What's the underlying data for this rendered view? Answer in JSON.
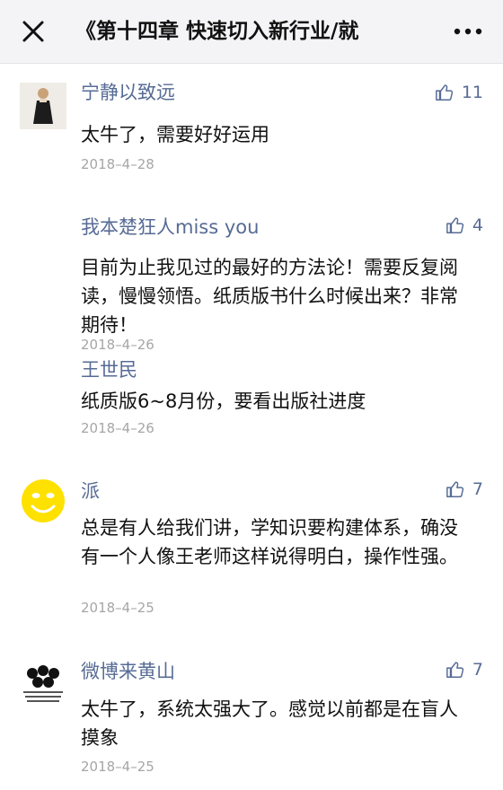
{
  "header": {
    "title": "《第十四章 快速切入新行业/就",
    "close_icon": "close-icon",
    "more_icon": "more-dots-icon"
  },
  "colors": {
    "nickname": "#576b95",
    "date": "#a6a6a6",
    "topbar_bg": "#f4f4f6"
  },
  "comments": [
    {
      "nickname": "宁静以致远",
      "likes": "11",
      "content": "太牛了，需要好好运用",
      "date": "2018–4–28"
    },
    {
      "nickname": "我本楚狂人miss you",
      "likes": "4",
      "content": "目前为止我见过的最好的方法论！需要反复阅读，慢慢领悟。纸质版书什么时候出来？非常期待！",
      "date": "2018–4–26",
      "reply": {
        "nickname": "王世民",
        "content": "纸质版6~8月份，要看出版社进度",
        "date": "2018–4–26"
      }
    },
    {
      "nickname": "派",
      "likes": "7",
      "content": "总是有人给我们讲，学知识要构建体系，确没有一个人像王老师这样说得明白，操作性强。",
      "date": "2018–4–25"
    },
    {
      "nickname": "微博来黄山",
      "likes": "7",
      "content": "太牛了，系统太强大了。感觉以前都是在盲人摸象",
      "date": "2018–4–25"
    }
  ]
}
